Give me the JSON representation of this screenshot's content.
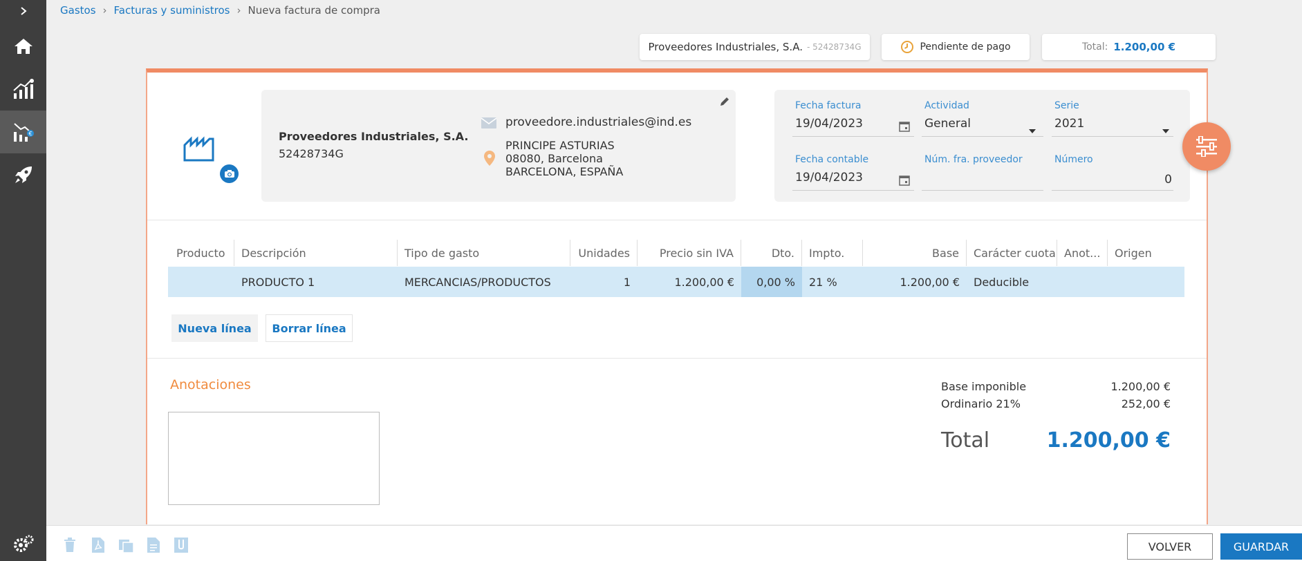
{
  "breadcrumb": {
    "items": [
      "Gastos",
      "Facturas y suministros"
    ],
    "current": "Nueva factura de compra"
  },
  "header_cards": {
    "supplier_name": "Proveedores Industriales, S.A.",
    "supplier_nif": "- 52428734G",
    "status": "Pendiente de pago",
    "total_label": "Total:",
    "total_value": "1.200,00 €"
  },
  "supplier": {
    "name": "Proveedores Industriales, S.A.",
    "nif": "52428734G",
    "email": "proveedore.industriales@ind.es",
    "address_line1": "PRINCIPE ASTURIAS",
    "address_line2": "08080, Barcelona",
    "address_line3": "BARCELONA, ESPAÑA"
  },
  "invoice_meta": {
    "fecha_factura_label": "Fecha factura",
    "fecha_factura": "19/04/2023",
    "actividad_label": "Actividad",
    "actividad": "General",
    "serie_label": "Serie",
    "serie": "2021",
    "fecha_contable_label": "Fecha contable",
    "fecha_contable": "19/04/2023",
    "num_fra_label": "Núm. fra. proveedor",
    "num_fra": "",
    "numero_label": "Número",
    "numero": "0"
  },
  "table": {
    "headers": [
      "Producto",
      "Descripción",
      "Tipo de gasto",
      "Unidades",
      "Precio sin IVA",
      "Dto.",
      "Impto.",
      "Base",
      "Carácter cuota",
      "Anot...",
      "Origen"
    ],
    "rows": [
      {
        "producto": "",
        "descripcion": "PRODUCTO 1",
        "tipo": "MERCANCIAS/PRODUCTOS",
        "unidades": "1",
        "precio": "1.200,00 €",
        "dto": "0,00 %",
        "impto": "21 %",
        "base": "1.200,00 €",
        "caracter": "Deducible",
        "anot": "",
        "origen": ""
      }
    ]
  },
  "actions": {
    "nueva_linea": "Nueva línea",
    "borrar_linea": "Borrar línea"
  },
  "annotations": {
    "title": "Anotaciones",
    "value": ""
  },
  "totals": {
    "base_label": "Base imponible",
    "base_value": "1.200,00 €",
    "iva_label": "Ordinario 21%",
    "iva_value": "252,00 €",
    "total_label": "Total",
    "total_value": "1.200,00 €"
  },
  "footer": {
    "volver": "VOLVER",
    "guardar": "GUARDAR"
  },
  "colors": {
    "accent_blue": "#1a78c2",
    "accent_orange": "#f08b64",
    "sidebar": "#3e3e3e",
    "row_highlight": "#d3e9f7"
  }
}
